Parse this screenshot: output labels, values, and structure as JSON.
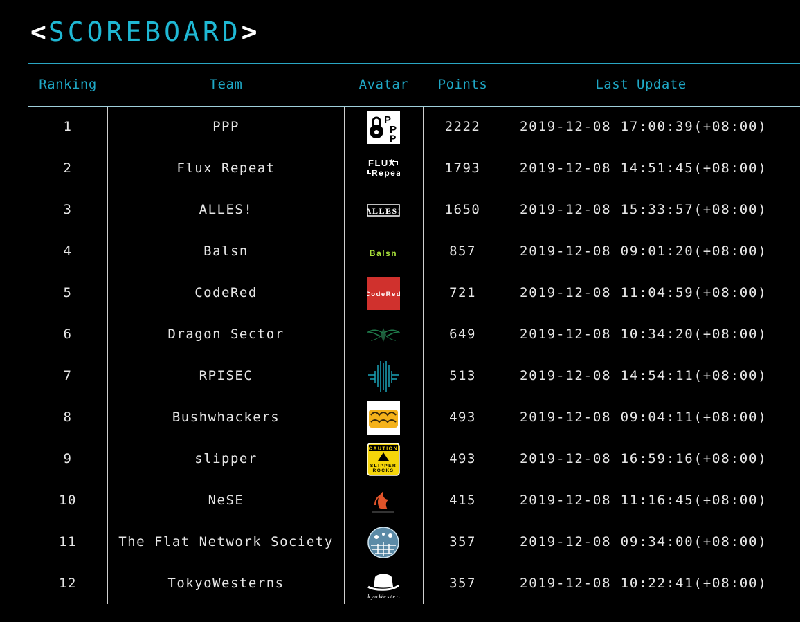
{
  "title": {
    "open": "<",
    "word": "SCOREBOARD",
    "close": ">"
  },
  "columns": {
    "ranking": "Ranking",
    "team": "Team",
    "avatar": "Avatar",
    "points": "Points",
    "last_update": "Last Update"
  },
  "rows": [
    {
      "rank": "1",
      "team": "PPP",
      "points": "2222",
      "updated": "2019-12-08 17:00:39(+08:00)",
      "avatar": "ppp-logo-icon",
      "avatar_text": "PPP"
    },
    {
      "rank": "2",
      "team": "Flux Repeat",
      "points": "1793",
      "updated": "2019-12-08 14:51:45(+08:00)",
      "avatar": "flux-repeat-logo-icon",
      "avatar_text": "FLUX Repeat"
    },
    {
      "rank": "3",
      "team": "ALLES!",
      "points": "1650",
      "updated": "2019-12-08 15:33:57(+08:00)",
      "avatar": "alles-logo-icon",
      "avatar_text": "ALLES!"
    },
    {
      "rank": "4",
      "team": "Balsn",
      "points": "857",
      "updated": "2019-12-08 09:01:20(+08:00)",
      "avatar": "balsn-logo-icon",
      "avatar_text": "Balsn"
    },
    {
      "rank": "5",
      "team": "CodeRed",
      "points": "721",
      "updated": "2019-12-08 11:04:59(+08:00)",
      "avatar": "codered-logo-icon",
      "avatar_text": "CodeRed"
    },
    {
      "rank": "6",
      "team": "Dragon Sector",
      "points": "649",
      "updated": "2019-12-08 10:34:20(+08:00)",
      "avatar": "dragon-sector-logo-icon",
      "avatar_text": ""
    },
    {
      "rank": "7",
      "team": "RPISEC",
      "points": "513",
      "updated": "2019-12-08 14:54:11(+08:00)",
      "avatar": "rpisec-logo-icon",
      "avatar_text": ""
    },
    {
      "rank": "8",
      "team": "Bushwhackers",
      "points": "493",
      "updated": "2019-12-08 09:04:11(+08:00)",
      "avatar": "bushwhackers-logo-icon",
      "avatar_text": ""
    },
    {
      "rank": "9",
      "team": "slipper",
      "points": "493",
      "updated": "2019-12-08 16:59:16(+08:00)",
      "avatar": "slipper-caution-logo-icon",
      "avatar_text": "CAUTION SLIPPER ROCKS"
    },
    {
      "rank": "10",
      "team": "NeSE",
      "points": "415",
      "updated": "2019-12-08 11:16:45(+08:00)",
      "avatar": "nese-logo-icon",
      "avatar_text": ""
    },
    {
      "rank": "11",
      "team": "The Flat Network Society",
      "points": "357",
      "updated": "2019-12-08 09:34:00(+08:00)",
      "avatar": "flat-network-society-logo-icon",
      "avatar_text": ""
    },
    {
      "rank": "12",
      "team": "TokyoWesterns",
      "points": "357",
      "updated": "2019-12-08 10:22:41(+08:00)",
      "avatar": "tokyowesterns-logo-icon",
      "avatar_text": "TokyoWesterns"
    }
  ],
  "colors": {
    "background": "#000000",
    "accent": "#1fb8d4",
    "text": "#e6e6e6",
    "header_text": "#1fa8c6"
  }
}
